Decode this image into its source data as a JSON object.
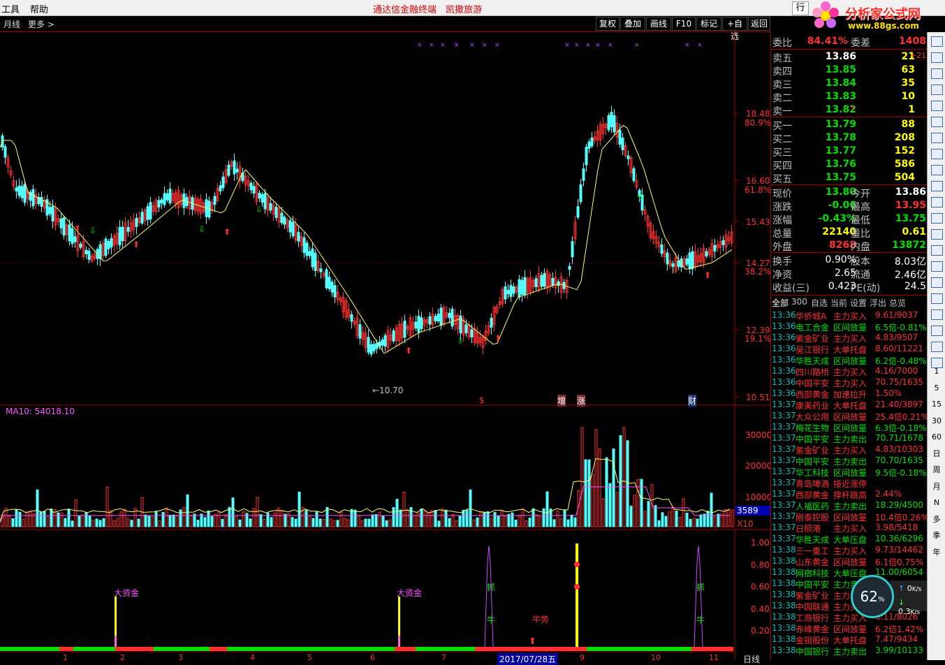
{
  "menu": {
    "tools": "工具",
    "help": "帮助",
    "title": "通达信金融终端　凯撒旅游",
    "trade": "行"
  },
  "logo": {
    "text": "分析家公式网",
    "url": "www.88gs.com"
  },
  "toolbar": {
    "period": "月线",
    "more": "更多 >",
    "buttons": [
      "复权",
      "叠加",
      "画线",
      "F10",
      "标记",
      "+自选",
      "返回"
    ]
  },
  "price_axis": [
    "18.48",
    "80.9%",
    "16.60",
    "61.8%",
    "15.43",
    "14.27",
    "38.2%",
    "12.39",
    "19.1%",
    "10.51"
  ],
  "vol_axis": [
    "30000",
    "20000",
    "10000"
  ],
  "vol_label": "MA10: 54018.10",
  "vol_cur": "3589",
  "vol_mult": "X10",
  "ind_axis": [
    "1.00",
    "0.80",
    "0.60",
    "0.40",
    "0.20"
  ],
  "chart_marks": {
    "low_price": "←10.70",
    "dollar": "$",
    "zeng": "增",
    "zhang": "涨",
    "cai": "财",
    "dazijin1": "大资金",
    "dazijin2": "大资金",
    "zhua1": "抓",
    "niu1": "牛",
    "niushi": "牛势",
    "zhua2": "抓",
    "niu2": "牛",
    "date_label": "2017/07/28五",
    "bottom_right": "日线"
  },
  "xaxis_ticks": [
    "1",
    "2",
    "3",
    "4",
    "5",
    "6",
    "7",
    "8",
    "9",
    "10",
    "11"
  ],
  "quote": {
    "weibi": {
      "label": "委比",
      "value": "84.41%",
      "label2": "委差",
      "value2": "1408"
    },
    "sell": [
      {
        "label": "卖五",
        "price": "13.86",
        "vol": "21",
        "chg": "+21"
      },
      {
        "label": "卖四",
        "price": "13.85",
        "vol": "63",
        "chg": ""
      },
      {
        "label": "卖三",
        "price": "13.84",
        "vol": "35",
        "chg": ""
      },
      {
        "label": "卖二",
        "price": "13.83",
        "vol": "10",
        "chg": ""
      },
      {
        "label": "卖一",
        "price": "13.82",
        "vol": "1",
        "chg": ""
      }
    ],
    "buy": [
      {
        "label": "买一",
        "price": "13.79",
        "vol": "88"
      },
      {
        "label": "买二",
        "price": "13.78",
        "vol": "208"
      },
      {
        "label": "买三",
        "price": "13.77",
        "vol": "152"
      },
      {
        "label": "买四",
        "price": "13.76",
        "vol": "586"
      },
      {
        "label": "买五",
        "price": "13.75",
        "vol": "504"
      }
    ],
    "stats": [
      {
        "l1": "现价",
        "v1": "13.80",
        "c1": "#00e000",
        "l2": "今开",
        "v2": "13.86",
        "c2": "#ffffff"
      },
      {
        "l1": "涨跌",
        "v1": "-0.06",
        "c1": "#00e000",
        "l2": "最高",
        "v2": "13.95",
        "c2": "#ff3030"
      },
      {
        "l1": "涨幅",
        "v1": "-0.43%",
        "c1": "#00e000",
        "l2": "最低",
        "v2": "13.75",
        "c2": "#00e000"
      },
      {
        "l1": "总量",
        "v1": "22140",
        "c1": "#ffff00",
        "l2": "量比",
        "v2": "0.61",
        "c2": "#ffff00"
      },
      {
        "l1": "外盘",
        "v1": "8268",
        "c1": "#ff3030",
        "l2": "内盘",
        "v2": "13872",
        "c2": "#00e000"
      }
    ],
    "stats2": [
      {
        "l1": "换手",
        "v1": "0.90%",
        "l2": "股本",
        "v2": "8.03亿"
      },
      {
        "l1": "净资",
        "v1": "2.65",
        "l2": "流通",
        "v2": "2.46亿"
      },
      {
        "l1": "收益(三)",
        "v1": "0.423",
        "l2": "PE(动)",
        "v2": "24.5"
      }
    ]
  },
  "tabs": [
    "全部",
    "300",
    "自选",
    "当前",
    "设置",
    "浮出",
    "总览"
  ],
  "trades": [
    {
      "t": "13:36",
      "n": "华侨城A",
      "k": "主力买入",
      "d": "9.61/9037",
      "nc": "#ff3030",
      "kc": "#ff3030",
      "dc": "#ff3030"
    },
    {
      "t": "13:36",
      "n": "电工合金",
      "k": "区间放量",
      "d": "6.5倍-0.81%",
      "nc": "#00e000",
      "kc": "#00e000",
      "dc": "#00e000"
    },
    {
      "t": "13:36",
      "n": "紫金矿业",
      "k": "主力买入",
      "d": "4.83/9507",
      "nc": "#ff3030",
      "kc": "#ff3030",
      "dc": "#ff3030"
    },
    {
      "t": "13:36",
      "n": "吴江银行",
      "k": "大单托盘",
      "d": "8.60/11221",
      "nc": "#ff3030",
      "kc": "#ff3030",
      "dc": "#ff3030"
    },
    {
      "t": "13:36",
      "n": "华胜天成",
      "k": "区间放量",
      "d": "6.2倍-0.48%",
      "nc": "#00e000",
      "kc": "#00e000",
      "dc": "#00e000"
    },
    {
      "t": "13:36",
      "n": "四川路桥",
      "k": "主力买入",
      "d": "4.16/7000",
      "nc": "#ff3030",
      "kc": "#ff3030",
      "dc": "#ff3030"
    },
    {
      "t": "13:36",
      "n": "中国平安",
      "k": "主力买入",
      "d": "70.75/1635",
      "nc": "#ff3030",
      "kc": "#ff3030",
      "dc": "#ff3030"
    },
    {
      "t": "13:36",
      "n": "西部黄金",
      "k": "加速拉升",
      "d": "1.50%",
      "nc": "#ff3030",
      "kc": "#ff3030",
      "dc": "#ff3030"
    },
    {
      "t": "13:37",
      "n": "康美药业",
      "k": "大单托盘",
      "d": "21.40/3897",
      "nc": "#ff3030",
      "kc": "#ff3030",
      "dc": "#ff3030"
    },
    {
      "t": "13:37",
      "n": "大众公用",
      "k": "区间放量",
      "d": "25.4倍0.21%",
      "nc": "#ff3030",
      "kc": "#ff3030",
      "dc": "#ff3030"
    },
    {
      "t": "13:37",
      "n": "梅花生物",
      "k": "区间放量",
      "d": "6.3倍-0.18%",
      "nc": "#00e000",
      "kc": "#00e000",
      "dc": "#00e000"
    },
    {
      "t": "13:37",
      "n": "中国平安",
      "k": "主力卖出",
      "d": "70.71/1678",
      "nc": "#00e000",
      "kc": "#00e000",
      "dc": "#00e000"
    },
    {
      "t": "13:37",
      "n": "紫金矿业",
      "k": "主力买入",
      "d": "4.83/10303",
      "nc": "#ff3030",
      "kc": "#ff3030",
      "dc": "#ff3030"
    },
    {
      "t": "13:37",
      "n": "中国平安",
      "k": "主力卖出",
      "d": "70.70/1635",
      "nc": "#00e000",
      "kc": "#00e000",
      "dc": "#00e000"
    },
    {
      "t": "13:37",
      "n": "华工科技",
      "k": "区间放量",
      "d": "9.5倍-0.18%",
      "nc": "#00e000",
      "kc": "#00e000",
      "dc": "#00e000"
    },
    {
      "t": "13:37",
      "n": "青岛啤酒",
      "k": "接近涨停",
      "d": "",
      "nc": "#ff3030",
      "kc": "#ff3030",
      "dc": "#ff3030"
    },
    {
      "t": "13:37",
      "n": "西部黄金",
      "k": "撑杆跳高",
      "d": "2.44%",
      "nc": "#ff3030",
      "kc": "#ff3030",
      "dc": "#ff3030"
    },
    {
      "t": "13:37",
      "n": "人福医药",
      "k": "主力卖出",
      "d": "18.29/4500",
      "nc": "#00e000",
      "kc": "#00e000",
      "dc": "#00e000"
    },
    {
      "t": "13:37",
      "n": "刚泰控股",
      "k": "区间放量",
      "d": "10.4倍0.26%",
      "nc": "#ff3030",
      "kc": "#ff3030",
      "dc": "#ff3030"
    },
    {
      "t": "13:37",
      "n": "日照港",
      "k": "主力买入",
      "d": "3.98/5418",
      "nc": "#ff3030",
      "kc": "#ff3030",
      "dc": "#ff3030"
    },
    {
      "t": "13:37",
      "n": "华胜天成",
      "k": "大单压盘",
      "d": "10.36/6296",
      "nc": "#00e000",
      "kc": "#00e000",
      "dc": "#00e000"
    },
    {
      "t": "13:38",
      "n": "三一重工",
      "k": "主力买入",
      "d": "9.73/14462",
      "nc": "#ff3030",
      "kc": "#ff3030",
      "dc": "#ff3030"
    },
    {
      "t": "13:38",
      "n": "山东黄金",
      "k": "区间放量",
      "d": "6.1倍0.75%",
      "nc": "#ff3030",
      "kc": "#ff3030",
      "dc": "#ff3030"
    },
    {
      "t": "13:38",
      "n": "网宿科技",
      "k": "大单压盘",
      "d": "11.00/6054",
      "nc": "#00e000",
      "kc": "#00e000",
      "dc": "#00e000"
    },
    {
      "t": "13:38",
      "n": "中国平安",
      "k": "主力卖出",
      "d": "",
      "nc": "#00e000",
      "kc": "#00e000",
      "dc": "#00e000"
    },
    {
      "t": "13:38",
      "n": "紫金矿业",
      "k": "主力买入",
      "d": "",
      "nc": "#ff3030",
      "kc": "#ff3030",
      "dc": "#ff3030"
    },
    {
      "t": "13:38",
      "n": "中国联通",
      "k": "主力买入",
      "d": "",
      "nc": "#ff3030",
      "kc": "#ff3030",
      "dc": "#ff3030"
    },
    {
      "t": "13:38",
      "n": "工商银行",
      "k": "主力买入",
      "d": "6.11/8026",
      "nc": "#ff3030",
      "kc": "#ff3030",
      "dc": "#ff3030"
    },
    {
      "t": "13:38",
      "n": "赤峰黄金",
      "k": "区间放量",
      "d": "6.2倍1.42%",
      "nc": "#ff3030",
      "kc": "#ff3030",
      "dc": "#ff3030"
    },
    {
      "t": "13:38",
      "n": "金钼股份",
      "k": "大单托盘",
      "d": "7.47/9434",
      "nc": "#ff3030",
      "kc": "#ff3030",
      "dc": "#ff3030"
    },
    {
      "t": "13:38",
      "n": "中国银行",
      "k": "主力卖出",
      "d": "3.99/10133",
      "nc": "#00e000",
      "kc": "#00e000",
      "dc": "#00e000"
    }
  ],
  "sidebar_labels": [
    "1",
    "5",
    "15",
    "30",
    "60",
    "日",
    "周",
    "月",
    "N",
    "多",
    "季",
    "年"
  ],
  "speed": {
    "percent": "62",
    "unit": "%",
    "up": "0",
    "down": "0.3",
    "rate_unit": "K/s"
  },
  "colors": {
    "up": "#ff3030",
    "down": "#54ffff",
    "ma": "#ffff66",
    "grid": "#a00000"
  }
}
